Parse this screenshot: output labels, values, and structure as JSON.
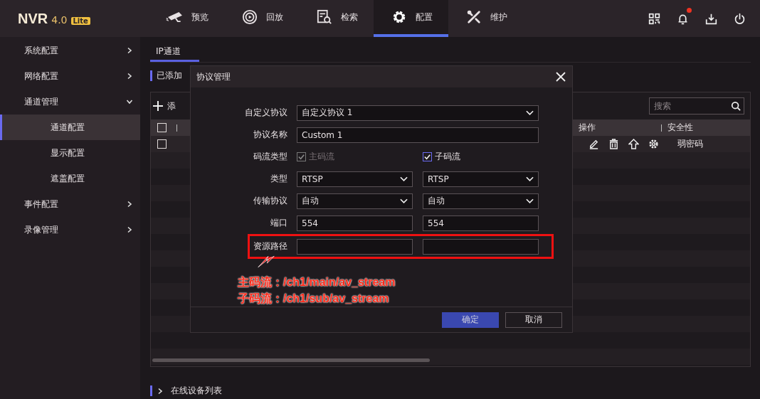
{
  "header": {
    "logo": {
      "name": "NVR",
      "version": "4.0",
      "badge": "Lite"
    },
    "nav": [
      {
        "label": "预览",
        "kind": "camera",
        "selected": false
      },
      {
        "label": "回放",
        "kind": "playback",
        "selected": false
      },
      {
        "label": "检索",
        "kind": "search-doc",
        "selected": false
      },
      {
        "label": "配置",
        "kind": "gear",
        "selected": true
      },
      {
        "label": "维护",
        "kind": "tools",
        "selected": false
      }
    ],
    "actions": [
      {
        "kind": "qr",
        "notification": false
      },
      {
        "kind": "bell",
        "notification": true
      },
      {
        "kind": "download",
        "notification": false
      },
      {
        "kind": "power",
        "notification": false
      }
    ]
  },
  "sidebar": {
    "items": [
      {
        "label": "系统配置",
        "expanded": false,
        "selected": false
      },
      {
        "label": "网络配置",
        "expanded": false,
        "selected": false
      },
      {
        "label": "通道管理",
        "expanded": true,
        "selected": false,
        "children": [
          {
            "label": "通道配置",
            "selected": true
          },
          {
            "label": "显示配置",
            "selected": false
          },
          {
            "label": "遮盖配置",
            "selected": false
          }
        ]
      },
      {
        "label": "事件配置",
        "expanded": false,
        "selected": false
      },
      {
        "label": "录像管理",
        "expanded": false,
        "selected": false
      }
    ]
  },
  "content": {
    "tabs": [
      {
        "label": "IP通道",
        "selected": true
      }
    ],
    "section_title": "已添加",
    "add_label": "添",
    "search": {
      "placeholder": "搜索"
    },
    "table": {
      "header_checked": false,
      "columns": [
        "操作",
        "安全性"
      ],
      "rows": [
        {
          "checked": false,
          "security": "弱密码"
        }
      ]
    },
    "footer_section": {
      "label": "在线设备列表",
      "expanded": false
    }
  },
  "dialog": {
    "title": "协议管理",
    "fields": [
      {
        "label": "自定义协议",
        "highlighted": false,
        "inputs": [
          {
            "kind": "select",
            "value": "自定义协议 1"
          }
        ]
      },
      {
        "label": "协议名称",
        "highlighted": false,
        "inputs": [
          {
            "kind": "text",
            "value": "Custom 1"
          }
        ]
      },
      {
        "label": "码流类型",
        "highlighted": false,
        "inputs": [
          {
            "kind": "check",
            "value": "主码流",
            "checked": true,
            "disabled": true
          },
          {
            "kind": "check",
            "value": "子码流",
            "checked": true,
            "disabled": false
          }
        ]
      },
      {
        "label": "类型",
        "highlighted": false,
        "inputs": [
          {
            "kind": "select",
            "value": "RTSP"
          },
          {
            "kind": "select",
            "value": "RTSP"
          }
        ]
      },
      {
        "label": "传输协议",
        "highlighted": false,
        "inputs": [
          {
            "kind": "select",
            "value": "自动"
          },
          {
            "kind": "select",
            "value": "自动"
          }
        ]
      },
      {
        "label": "端口",
        "highlighted": false,
        "inputs": [
          {
            "kind": "text",
            "value": "554"
          },
          {
            "kind": "text",
            "value": "554"
          }
        ]
      },
      {
        "label": "资源路径",
        "highlighted": true,
        "inputs": [
          {
            "kind": "text"
          },
          {
            "kind": "text"
          }
        ]
      }
    ],
    "annotation": [
      "主码流：/ch1/main/av_stream",
      "子码流：/ch1/sub/av_stream"
    ],
    "buttons": [
      {
        "label": "确定",
        "kind": "primary"
      },
      {
        "label": "取消",
        "kind": "secondary"
      }
    ]
  }
}
